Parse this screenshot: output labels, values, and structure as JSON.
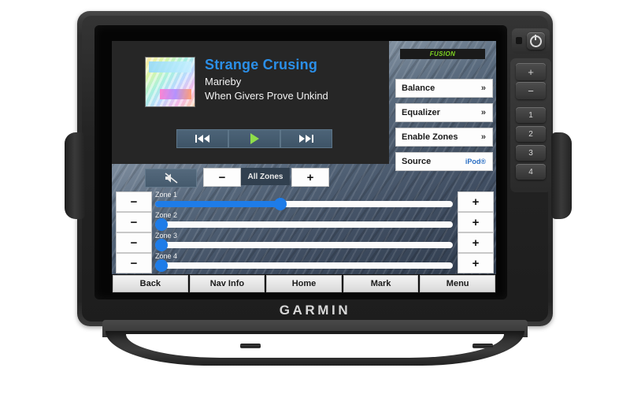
{
  "device": {
    "brand": "GARMIN",
    "hardware_buttons": [
      {
        "name": "power",
        "label": "⏻"
      },
      {
        "name": "volume-up",
        "label": "+"
      },
      {
        "name": "volume-down",
        "label": "−"
      },
      {
        "name": "preset-1",
        "label": "1"
      },
      {
        "name": "preset-2",
        "label": "2"
      },
      {
        "name": "preset-3",
        "label": "3"
      },
      {
        "name": "preset-4",
        "label": "4"
      }
    ]
  },
  "media": {
    "title": "Strange Crusing",
    "artist": "Marieby",
    "album": "When Givers Prove Unkind",
    "title_color": "#2b8fe8",
    "transport": [
      {
        "name": "previous",
        "icon": "skip-back-icon"
      },
      {
        "name": "play",
        "icon": "play-icon"
      },
      {
        "name": "next",
        "icon": "skip-forward-icon"
      }
    ]
  },
  "right_panel": {
    "logo": "FUSION",
    "logo_color": "#7ed321",
    "items": [
      {
        "label": "Balance",
        "chevron": "»",
        "value": ""
      },
      {
        "label": "Equalizer",
        "chevron": "»",
        "value": ""
      },
      {
        "label": "Enable Zones",
        "chevron": "»",
        "value": ""
      },
      {
        "label": "Source",
        "chevron": "",
        "value": "iPod®"
      }
    ]
  },
  "zone_controls": {
    "mute_icon": "mute-icon",
    "all_zones_label": "All Zones",
    "minus_label": "−",
    "plus_label": "+",
    "zones": [
      {
        "label": "Zone 1",
        "value": 42
      },
      {
        "label": "Zone 2",
        "value": 2
      },
      {
        "label": "Zone 3",
        "value": 2
      },
      {
        "label": "Zone 4",
        "value": 2
      }
    ],
    "accent_color": "#1e7ce8"
  },
  "nav_bar": {
    "buttons": [
      "Back",
      "Nav Info",
      "Home",
      "Mark",
      "Menu"
    ]
  }
}
